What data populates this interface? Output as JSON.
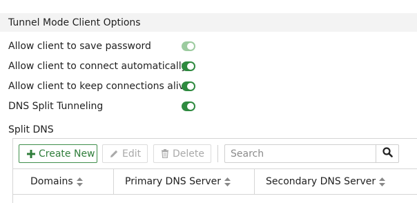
{
  "section": {
    "title": "Tunnel Mode Client Options"
  },
  "options": [
    {
      "label": "Allow client to save password",
      "enabled": true,
      "disabled": true
    },
    {
      "label": "Allow client to connect automatically",
      "enabled": true,
      "disabled": false
    },
    {
      "label": "Allow client to keep connections alive",
      "enabled": true,
      "disabled": false
    },
    {
      "label": "DNS Split Tunneling",
      "enabled": true,
      "disabled": false
    }
  ],
  "split_dns": {
    "label": "Split DNS",
    "toolbar": {
      "create_label": "Create New",
      "edit_label": "Edit",
      "delete_label": "Delete"
    },
    "search": {
      "placeholder": "Search",
      "value": ""
    },
    "columns": [
      "Domains",
      "Primary DNS Server",
      "Secondary DNS Server"
    ],
    "rows": [
      {
        "domains": "",
        "primary": "",
        "secondary": ""
      }
    ]
  },
  "colors": {
    "toggle_on": "#2e8a3f",
    "toggle_disabled": "#9ccb9f",
    "create_accent": "#2f7d3a",
    "header_bg": "#f3f3f3"
  },
  "icons": {
    "create": "plus-icon",
    "edit": "pencil-icon",
    "delete": "trash-icon",
    "search": "search-icon",
    "sort": "sort-icon"
  }
}
